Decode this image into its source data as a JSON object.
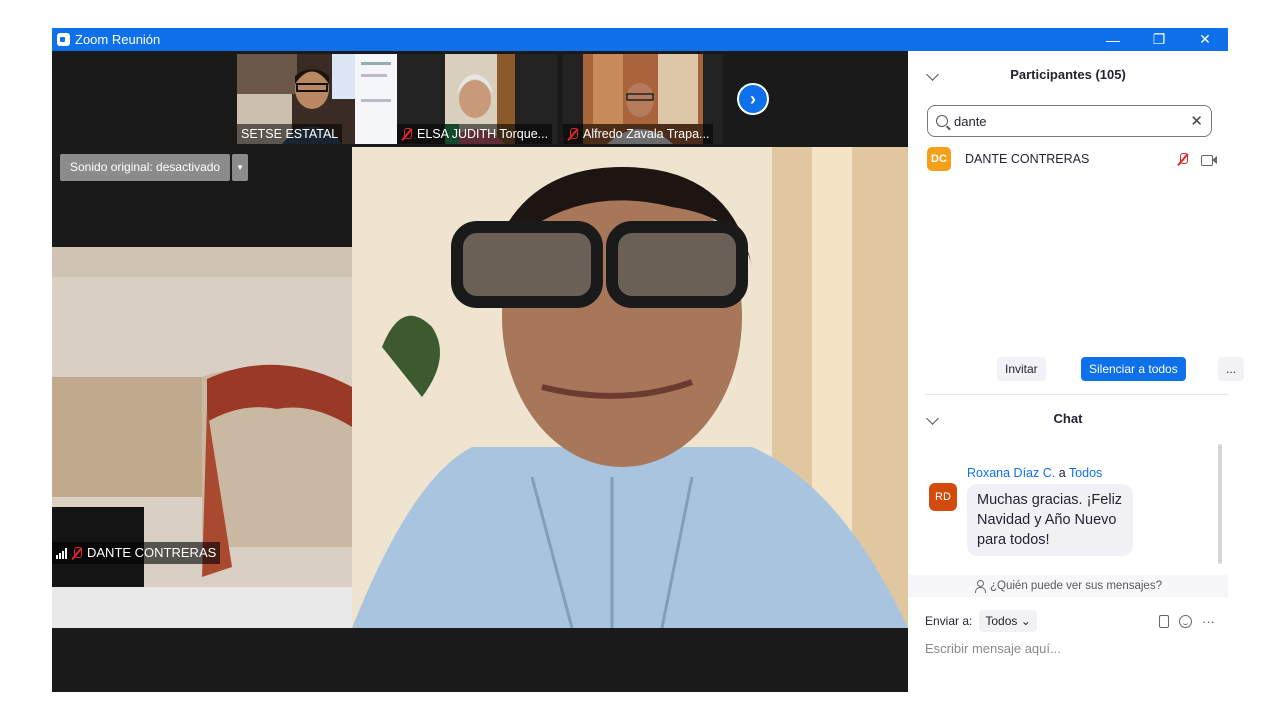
{
  "window": {
    "title": "Zoom Reunión",
    "minimize": "—",
    "restore": "❐",
    "close": "✕"
  },
  "video": {
    "thumbnails": [
      {
        "name": "SETSE ESTATAL",
        "muted": false
      },
      {
        "name": "ELSA JUDITH Torque...",
        "muted": true
      },
      {
        "name": "Alfredo Zavala Trapa...",
        "muted": true
      }
    ],
    "next_icon": "chevron-right-icon",
    "original_sound": "Sonido original: desactivado",
    "original_sound_dropdown": "▼",
    "speaker_name": "DANTE CONTRERAS"
  },
  "participants": {
    "header": "Participantes (105)",
    "search_value": "dante",
    "clear_icon": "✕",
    "rows": [
      {
        "initials": "DC",
        "name": "DANTE CONTRERAS",
        "avatar_color": "#f5a01a"
      }
    ],
    "actions": {
      "invite": "Invitar",
      "mute_all": "Silenciar a todos",
      "more": "..."
    }
  },
  "chat": {
    "header": "Chat",
    "message": {
      "sender": "Roxana Díaz C.",
      "to_word": "a",
      "recipient": "Todos",
      "initials": "RD",
      "avatar_color": "#d24a0c",
      "text": "Muchas gracias. ¡Feliz Navidad y Año Nuevo para todos!"
    },
    "who_can_see": "¿Quién puede ver sus mensajes?",
    "send_to_label": "Enviar a:",
    "send_to_value": "Todos",
    "more_icon": "···",
    "input_placeholder": "Escribir mensaje aquí..."
  },
  "colors": {
    "brand": "#0e71eb",
    "muted": "#e02828"
  }
}
